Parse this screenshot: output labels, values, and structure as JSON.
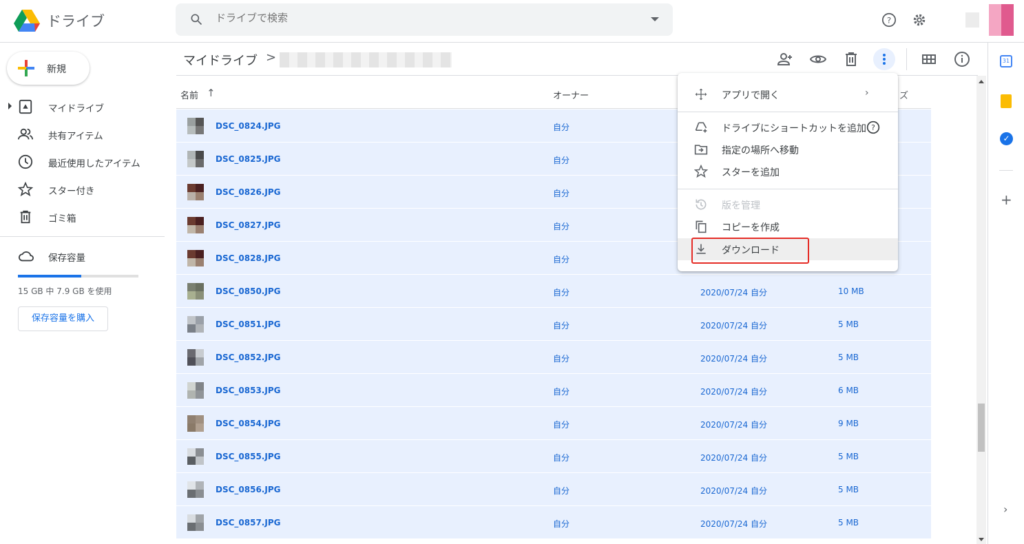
{
  "header": {
    "brand": "ドライブ",
    "search_placeholder": "ドライブで検索"
  },
  "sidebar": {
    "new_label": "新規",
    "items": [
      {
        "label": "マイドライブ"
      },
      {
        "label": "共有アイテム"
      },
      {
        "label": "最近使用したアイテム"
      },
      {
        "label": "スター付き"
      },
      {
        "label": "ゴミ箱"
      }
    ],
    "storage_label": "保存容量",
    "storage_used_fraction": 0.527,
    "usage_text": "15 GB 中 7.9 GB を使用",
    "buy_label": "保存容量を購入"
  },
  "breadcrumb": {
    "root": "マイドライブ",
    "sep": ">"
  },
  "columns": {
    "name": "名前",
    "sort": "↑",
    "owner": "オーナー",
    "size_partial": "ズ"
  },
  "files": [
    {
      "name": "DSC_0824.JPG",
      "owner": "自分",
      "date": "",
      "size": "",
      "c": [
        "#9aa0a0",
        "#555",
        "#b6bcbc",
        "#777"
      ]
    },
    {
      "name": "DSC_0825.JPG",
      "owner": "自分",
      "date": "",
      "size": "",
      "c": [
        "#b0b5b5",
        "#4a4a4a",
        "#c4c8c8",
        "#6a6a6a"
      ]
    },
    {
      "name": "DSC_0826.JPG",
      "owner": "自分",
      "date": "",
      "size": "",
      "c": [
        "#6b3b30",
        "#4a2020",
        "#b9b0a8",
        "#9a8070"
      ]
    },
    {
      "name": "DSC_0827.JPG",
      "owner": "自分",
      "date": "",
      "size": "",
      "c": [
        "#6b3b30",
        "#4a2020",
        "#c0b6a8",
        "#9a8070"
      ]
    },
    {
      "name": "DSC_0828.JPG",
      "owner": "自分",
      "date": "",
      "size": "",
      "c": [
        "#6b3b30",
        "#4a2020",
        "#c0b6a8",
        "#9a8070"
      ]
    },
    {
      "name": "DSC_0850.JPG",
      "owner": "自分",
      "date": "2020/07/24 自分",
      "size": "10 MB",
      "c": [
        "#7a8070",
        "#6a7060",
        "#a8b090",
        "#8a9078"
      ]
    },
    {
      "name": "DSC_0851.JPG",
      "owner": "自分",
      "date": "2020/07/24 自分",
      "size": "5 MB",
      "c": [
        "#c0c4c8",
        "#9aa0a8",
        "#7a8088",
        "#b0b4b8"
      ]
    },
    {
      "name": "DSC_0852.JPG",
      "owner": "自分",
      "date": "2020/07/24 自分",
      "size": "5 MB",
      "c": [
        "#6a6a70",
        "#c8ccd0",
        "#505058",
        "#a0a4a8"
      ]
    },
    {
      "name": "DSC_0853.JPG",
      "owner": "自分",
      "date": "2020/07/24 自分",
      "size": "6 MB",
      "c": [
        "#d0d4d0",
        "#808488",
        "#b0b4b0",
        "#909498"
      ]
    },
    {
      "name": "DSC_0854.JPG",
      "owner": "自分",
      "date": "2020/07/24 自分",
      "size": "9 MB",
      "c": [
        "#908070",
        "#a09080",
        "#8a7a68",
        "#b0a090"
      ]
    },
    {
      "name": "DSC_0855.JPG",
      "owner": "自分",
      "date": "2020/07/24 自分",
      "size": "5 MB",
      "c": [
        "#d8dce0",
        "#8a8e92",
        "#5a5e62",
        "#c0c4c8"
      ]
    },
    {
      "name": "DSC_0856.JPG",
      "owner": "自分",
      "date": "2020/07/24 自分",
      "size": "5 MB",
      "c": [
        "#e0e4e8",
        "#b0b4b8",
        "#6a6e72",
        "#8a8e92"
      ]
    },
    {
      "name": "DSC_0857.JPG",
      "owner": "自分",
      "date": "2020/07/24 自分",
      "size": "5 MB",
      "c": [
        "#d8dce0",
        "#a0a4a8",
        "#6a6e72",
        "#8a8e92"
      ]
    }
  ],
  "menu": {
    "open_with": "アプリで開く",
    "add_shortcut": "ドライブにショートカットを追加",
    "move": "指定の場所へ移動",
    "star": "スターを追加",
    "versions": "版を管理",
    "copy": "コピーを作成",
    "download": "ダウンロード"
  },
  "colors": {
    "accent": "#1a73e8",
    "selected_bg": "#e8f0fe",
    "highlight": "#e52b25"
  }
}
